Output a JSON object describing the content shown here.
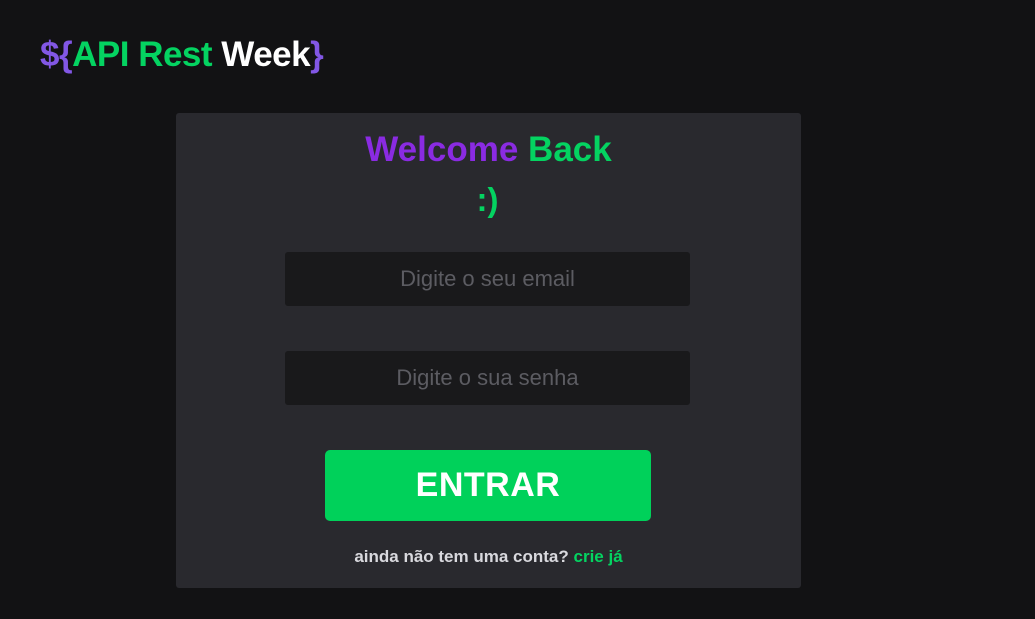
{
  "logo": {
    "prefix": "${",
    "word1": "API",
    "word2": "Rest",
    "word3": "Week",
    "suffix": "}"
  },
  "card": {
    "title_word1": "Welcome",
    "title_word2": "Back",
    "smiley": ":)",
    "email_placeholder": "Digite o seu email",
    "email_value": "",
    "password_placeholder": "Digite o sua senha",
    "password_value": "",
    "submit_label": "ENTRAR",
    "signup_text": "ainda não tem uma conta?",
    "signup_link": "crie já"
  },
  "colors": {
    "background": "#121214",
    "card": "#29292e",
    "input": "#19191b",
    "accent_green": "#04d361",
    "accent_purple": "#8a2be2",
    "button": "#00d15a"
  }
}
